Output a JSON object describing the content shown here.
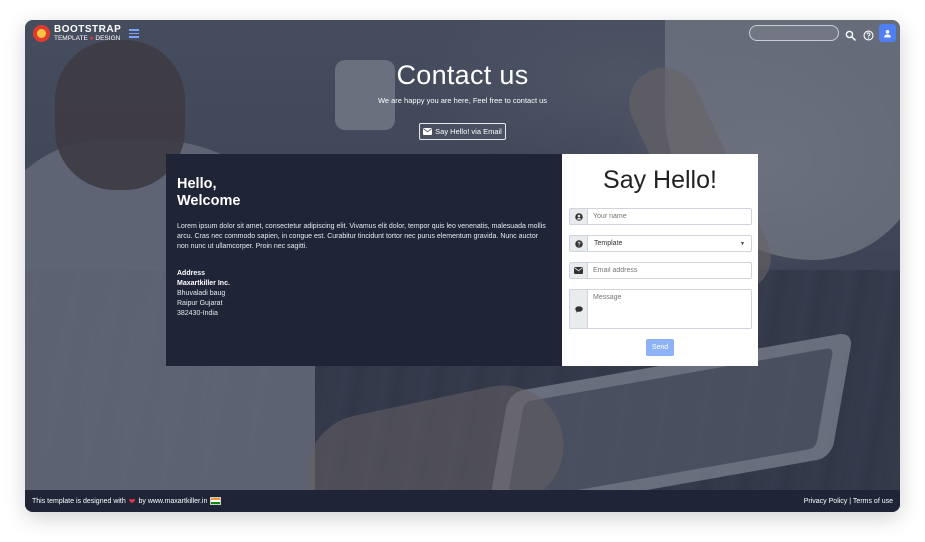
{
  "brand": {
    "name": "BOOTSTRAP",
    "tagline_left": "TEMPLATE",
    "tagline_right": "DESIGN"
  },
  "navbar": {
    "menu_icon": "hamburger-icon",
    "search_placeholder": "",
    "icons": [
      "search-icon",
      "help-icon",
      "user-icon"
    ],
    "accent": "#4f7ff0"
  },
  "hero": {
    "title": "Contact us",
    "subtitle": "We are happy you are here, Feel free to contact us",
    "email_button_label": "Say Hello! via Email"
  },
  "info": {
    "greeting_line1": "Hello,",
    "greeting_line2": "Welcome",
    "body": "Lorem ipsum dolor sit amet, consectetur adipiscing elit. Vivamus elit dolor, tempor quis leo venenatis, malesuada mollis arcu. Cras nec commodo sapien, in congue est. Curabitur tincidunt tortor nec purus elementum gravida. Nunc auctor non nunc ut ullamcorper. Proin nec sagitti.",
    "address_label": "Address",
    "address_lines": [
      "Maxartkiller Inc.",
      "Bhuvaladi baug",
      "Raipur Gujarat",
      "382430-India"
    ],
    "panel_color": "#1f2537"
  },
  "form": {
    "title": "Say Hello!",
    "name_placeholder": "Your name",
    "template_selected": "Template",
    "email_placeholder": "Email address",
    "message_placeholder": "Message",
    "send_label": "Send",
    "send_color": "#8db3f6"
  },
  "footer": {
    "left_prefix": "This template is designed with",
    "left_suffix": "by www.maxartkiller.in",
    "privacy": "Privacy Policy",
    "separator": "|",
    "terms": "Terms of use"
  }
}
